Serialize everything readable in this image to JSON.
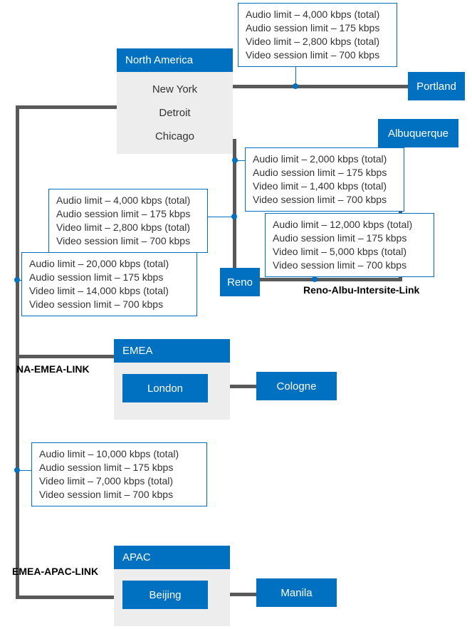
{
  "regions": {
    "na": {
      "title": "North America",
      "cities": [
        "New York",
        "Detroit",
        "Chicago"
      ]
    },
    "emea": {
      "title": "EMEA",
      "main_city": "London"
    },
    "apac": {
      "title": "APAC",
      "main_city": "Beijing"
    }
  },
  "sites": {
    "portland": "Portland",
    "albuquerque": "Albuquerque",
    "reno": "Reno",
    "cologne": "Cologne",
    "manila": "Manila"
  },
  "limits": {
    "na_top": {
      "line1": "Audio limit – 4,000 kbps (total)",
      "line2": "Audio session limit – 175 kbps",
      "line3": "Video limit – 2,800 kbps (total)",
      "line4": "Video session limit – 700 kbps"
    },
    "na_left_mid": {
      "line1": "Audio limit – 4,000 kbps (total)",
      "line2": "Audio session limit – 175 kbps",
      "line3": "Video limit – 2,800 kbps (total)",
      "line4": "Video session limit – 700 kbps"
    },
    "na_emea": {
      "line1": "Audio limit – 20,000 kbps  (total)",
      "line2": "Audio session limit – 175 kbps",
      "line3": "Video limit – 14,000 kbps  (total)",
      "line4": "Video session limit – 700 kbps"
    },
    "albu": {
      "line1": "Audio limit – 2,000 kbps (total)",
      "line2": "Audio session limit – 175 kbps",
      "line3": "Video limit – 1,400 kbps (total)",
      "line4": "Video session limit – 700 kbps"
    },
    "reno_albu": {
      "line1": "Audio limit – 12,000 kbps  (total)",
      "line2": "Audio session limit – 175 kbps",
      "line3": "Video limit – 5,000 kbps (total)",
      "line4": "Video session limit – 700 kbps"
    },
    "emea_apac": {
      "line1": "Audio limit – 10,000 kbps  (total)",
      "line2": "Audio session limit – 175 kbps",
      "line3": "Video limit – 7,000 kbps  (total)",
      "line4": "Video session limit – 700 kbps"
    }
  },
  "link_labels": {
    "na_emea": "NA-EMEA-LINK",
    "emea_apac": "EMEA-APAC-LINK",
    "reno_albu": "Reno-Albu-Intersite-Link"
  }
}
